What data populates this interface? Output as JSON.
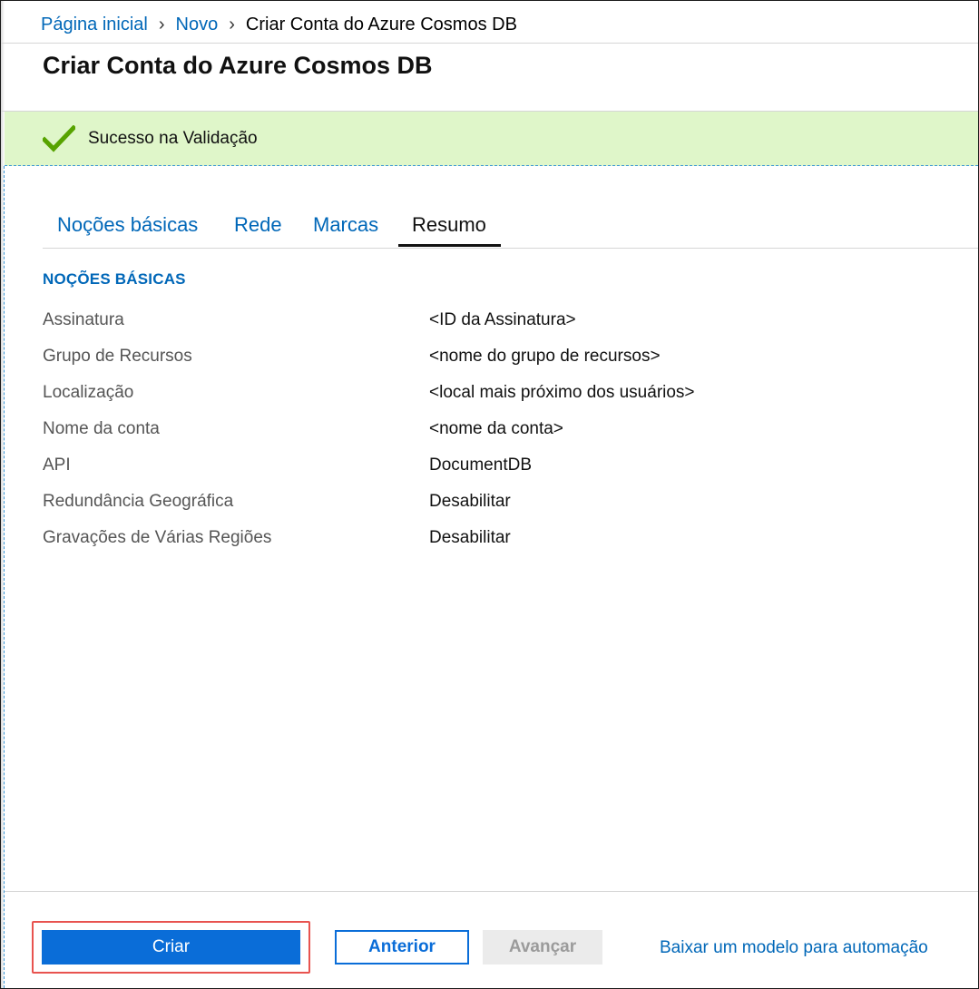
{
  "breadcrumb": {
    "home": "Página inicial",
    "new": "Novo",
    "current": "Criar Conta do Azure Cosmos DB"
  },
  "page_title": "Criar Conta do Azure Cosmos DB",
  "validation": {
    "message": "Sucesso na Validação",
    "color": "#dff6c9",
    "icon": "checkmark-icon"
  },
  "tabs": [
    {
      "label": "Noções básicas",
      "active": false
    },
    {
      "label": "Rede",
      "active": false
    },
    {
      "label": "Marcas",
      "active": false
    },
    {
      "label": "Resumo",
      "active": true
    }
  ],
  "summary": {
    "heading": "NOÇÕES BÁSICAS",
    "rows": [
      {
        "label": "Assinatura",
        "value": "<ID da Assinatura>"
      },
      {
        "label": "Grupo de Recursos",
        "value": "<nome do grupo de recursos>"
      },
      {
        "label": "Localização",
        "value": "<local mais próximo dos usuários>"
      },
      {
        "label": "Nome da conta",
        "value": "<nome da conta>"
      },
      {
        "label": "API",
        "value": "DocumentDB"
      },
      {
        "label": "Redundância Geográfica",
        "value": "Desabilitar"
      },
      {
        "label": "Gravações de Várias Regiões",
        "value": "Desabilitar"
      }
    ]
  },
  "footer": {
    "create_label": "Criar",
    "previous_label": "Anterior",
    "next_label": "Avançar",
    "download_link": "Baixar um modelo para automação"
  },
  "colors": {
    "accent": "#0067b8",
    "primary_button": "#0a6dd8",
    "highlight": "#e8534f",
    "success_check": "#57a300"
  }
}
